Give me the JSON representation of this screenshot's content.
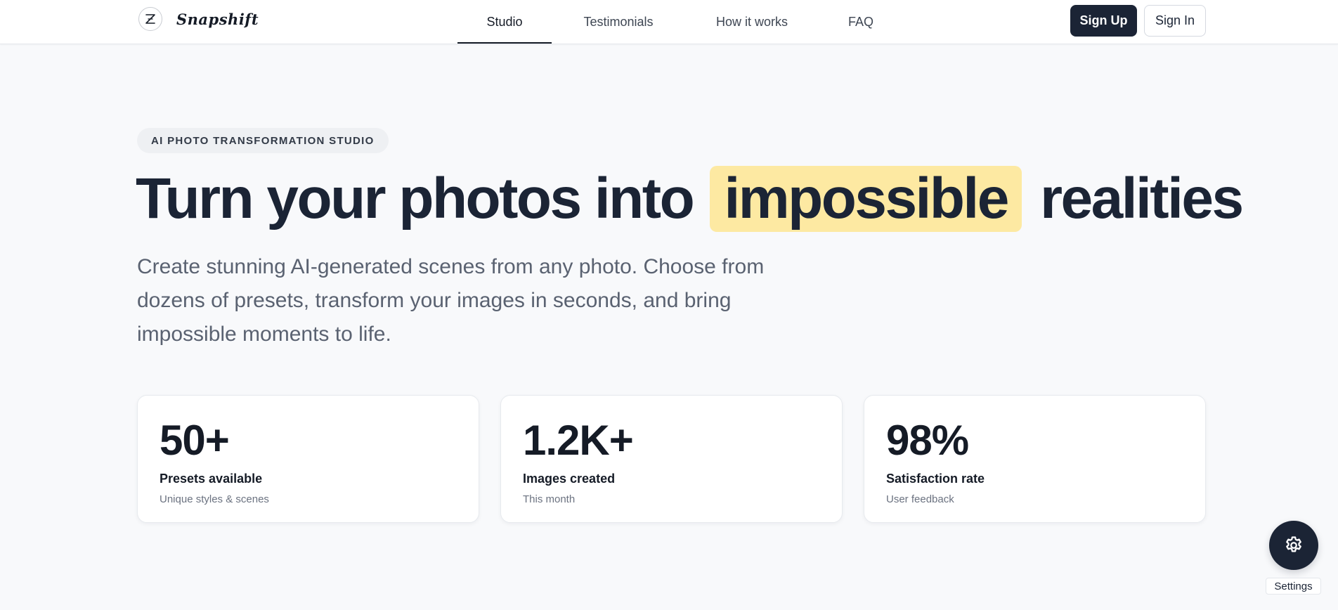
{
  "brand": {
    "logo_letter": "Z",
    "name": "Snapshift"
  },
  "nav": {
    "items": [
      {
        "label": "Studio",
        "active": true
      },
      {
        "label": "Testimonials",
        "active": false
      },
      {
        "label": "How it works",
        "active": false
      },
      {
        "label": "FAQ",
        "active": false
      }
    ]
  },
  "auth": {
    "signup_label": "Sign Up",
    "signin_label": "Sign In"
  },
  "hero": {
    "badge": "AI PHOTO TRANSFORMATION STUDIO",
    "headline_before": "Turn your photos into",
    "headline_highlight": "impossible",
    "headline_after": "realities",
    "subtitle": "Create stunning AI-generated scenes from any photo. Choose from dozens of presets, transform your images in seconds, and bring impossible moments to life."
  },
  "stats": [
    {
      "value": "50+",
      "label": "Presets available",
      "sub": "Unique styles & scenes"
    },
    {
      "value": "1.2K+",
      "label": "Images created",
      "sub": "This month"
    },
    {
      "value": "98%",
      "label": "Satisfaction rate",
      "sub": "User feedback"
    }
  ],
  "settings": {
    "icon": "gear-icon",
    "label": "Settings"
  },
  "colors": {
    "primary": "#1b2435",
    "highlight": "#fde9a2",
    "background": "#f8f9fb"
  }
}
